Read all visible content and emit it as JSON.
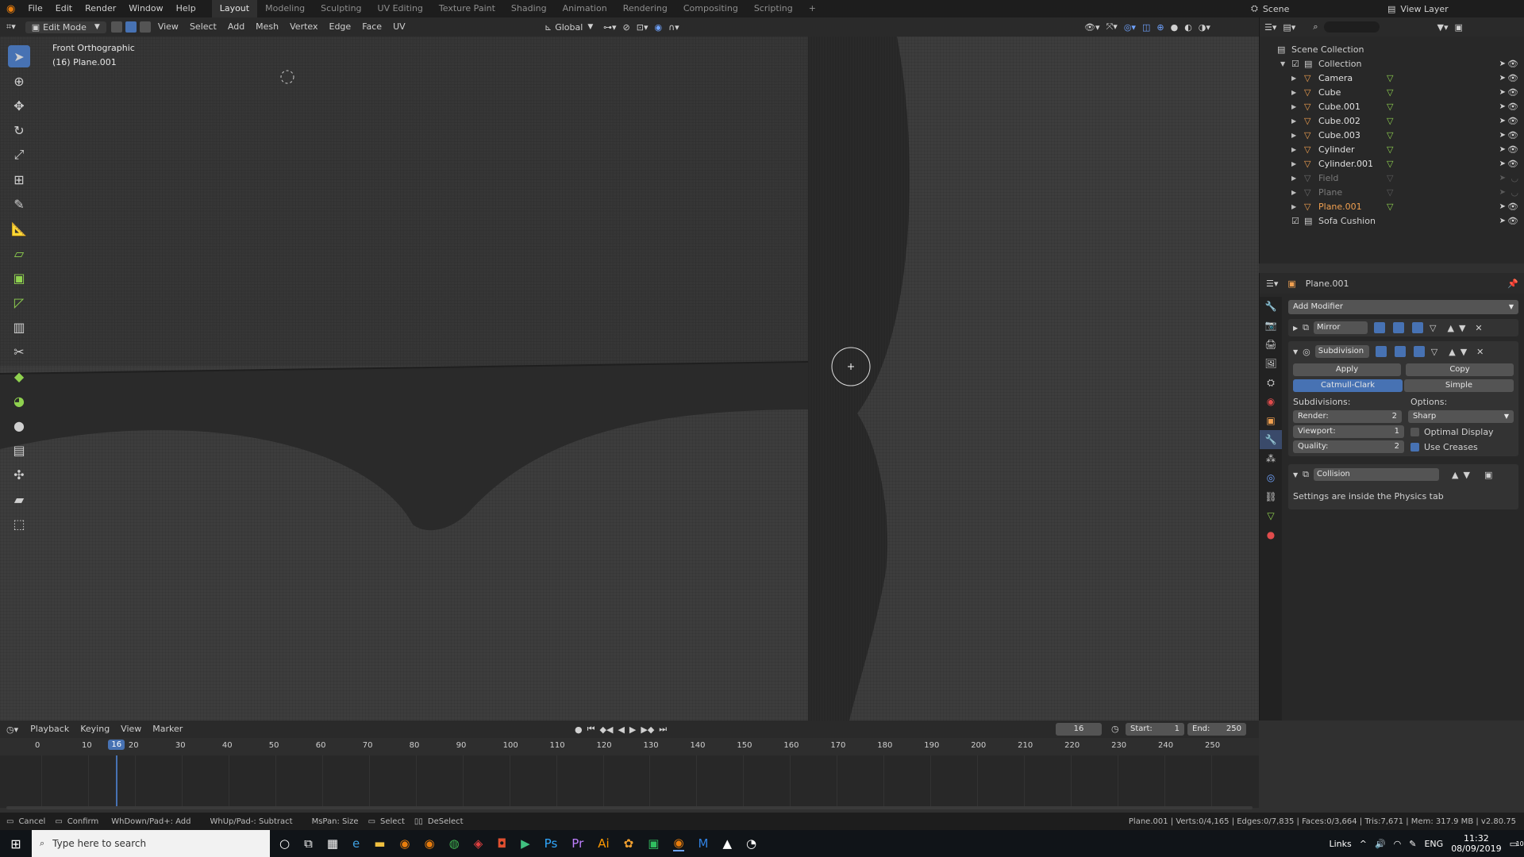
{
  "app": {
    "menus": [
      "File",
      "Edit",
      "Render",
      "Window",
      "Help"
    ],
    "workspaces": [
      "Layout",
      "Modeling",
      "Sculpting",
      "UV Editing",
      "Texture Paint",
      "Shading",
      "Animation",
      "Rendering",
      "Compositing",
      "Scripting"
    ],
    "active_workspace": "Layout",
    "add_workspace": "+",
    "scene": "Scene",
    "view_layer": "View Layer"
  },
  "viewport_header": {
    "mode": "Edit Mode",
    "menus": [
      "View",
      "Select",
      "Add",
      "Mesh",
      "Vertex",
      "Edge",
      "Face",
      "UV"
    ],
    "orientation": "Global"
  },
  "viewport": {
    "view_name": "Front Orthographic",
    "object_label": "(16) Plane.001"
  },
  "outliner": {
    "root": "Scene Collection",
    "collection": "Collection",
    "items": [
      {
        "name": "Camera",
        "color": "#e0e0e0",
        "enabled": true
      },
      {
        "name": "Cube",
        "color": "#e0e0e0",
        "enabled": true
      },
      {
        "name": "Cube.001",
        "color": "#e0e0e0",
        "enabled": true
      },
      {
        "name": "Cube.002",
        "color": "#e0e0e0",
        "enabled": true
      },
      {
        "name": "Cube.003",
        "color": "#e0e0e0",
        "enabled": true
      },
      {
        "name": "Cylinder",
        "color": "#e0e0e0",
        "enabled": true
      },
      {
        "name": "Cylinder.001",
        "color": "#e0e0e0",
        "enabled": true
      },
      {
        "name": "Field",
        "color": "#7a7a7a",
        "enabled": false
      },
      {
        "name": "Plane",
        "color": "#7a7a7a",
        "enabled": false
      },
      {
        "name": "Plane.001",
        "color": "#f0a050",
        "enabled": true
      }
    ],
    "sub_collection": "Sofa Cushion"
  },
  "properties": {
    "object": "Plane.001",
    "add_modifier": "Add Modifier",
    "modifiers": {
      "mirror": "Mirror",
      "subdivision": "Subdivision",
      "apply": "Apply",
      "copy": "Copy",
      "catmull": "Catmull-Clark",
      "simple": "Simple",
      "subdivisions_label": "Subdivisions:",
      "options_label": "Options:",
      "render_label": "Render:",
      "render_value": "2",
      "viewport_label": "Viewport:",
      "viewport_value": "1",
      "quality_label": "Quality:",
      "quality_value": "2",
      "sharp": "Sharp",
      "optimal_display": "Optimal Display",
      "use_creases": "Use Creases",
      "collision": "Collision",
      "collision_note": "Settings are inside the Physics tab"
    }
  },
  "timeline": {
    "menus": [
      "Playback",
      "Keying",
      "View",
      "Marker"
    ],
    "current_frame": "16",
    "start_label": "Start:",
    "start": "1",
    "end_label": "End:",
    "end": "250",
    "ticks": [
      "0",
      "10",
      "20",
      "30",
      "40",
      "50",
      "60",
      "70",
      "80",
      "90",
      "100",
      "110",
      "120",
      "130",
      "140",
      "150",
      "160",
      "170",
      "180",
      "190",
      "200",
      "210",
      "220",
      "230",
      "240",
      "250"
    ],
    "playhead": "16"
  },
  "status_bar": {
    "cancel": "Cancel",
    "confirm": "Confirm",
    "add": "WhDown/Pad+: Add",
    "subtract": "WhUp/Pad-: Subtract",
    "size": "MsPan: Size",
    "select": "Select",
    "deselect": "DeSelect",
    "stats": "Plane.001 | Verts:0/4,165 | Edges:0/7,835 | Faces:0/3,664 | Tris:7,671 | Mem: 317.9 MB | v2.80.75"
  },
  "taskbar": {
    "search_placeholder": "Type here to search",
    "links": "Links",
    "lang": "ENG",
    "time": "11:32",
    "date": "08/09/2019",
    "notif_count": "10"
  }
}
